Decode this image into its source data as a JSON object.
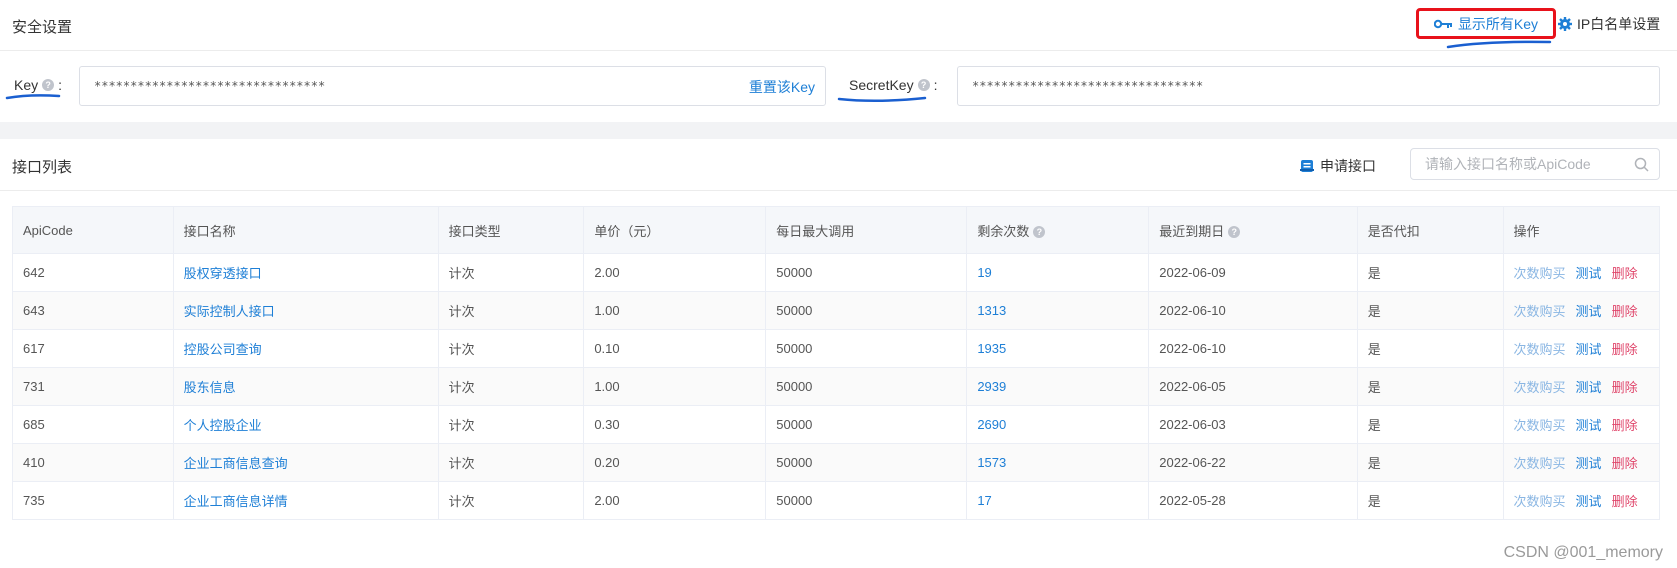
{
  "security": {
    "title": "安全设置",
    "show_all_keys_label": "显示所有Key",
    "ip_whitelist_label": "IP白名单设置",
    "key_label": "Key",
    "key_value": "********************************",
    "reset_key_label": "重置该Key",
    "secret_key_label": "SecretKey",
    "secret_key_value": "********************************",
    "colon": ":"
  },
  "api_list": {
    "title": "接口列表",
    "apply_label": "申请接口",
    "search_placeholder": "请输入接口名称或ApiCode",
    "columns": [
      "ApiCode",
      "接口名称",
      "接口类型",
      "单价（元）",
      "每日最大调用",
      "剩余次数",
      "最近到期日",
      "是否代扣",
      "操作"
    ],
    "actions": {
      "buy": "次数购买",
      "test": "测试",
      "delete": "删除"
    },
    "rows": [
      {
        "code": "642",
        "name": "股权穿透接口",
        "type": "计次",
        "price": "2.00",
        "max_daily": "50000",
        "remaining": "19",
        "expiry": "2022-06-09",
        "deduct": "是"
      },
      {
        "code": "643",
        "name": "实际控制人接口",
        "type": "计次",
        "price": "1.00",
        "max_daily": "50000",
        "remaining": "1313",
        "expiry": "2022-06-10",
        "deduct": "是"
      },
      {
        "code": "617",
        "name": "控股公司查询",
        "type": "计次",
        "price": "0.10",
        "max_daily": "50000",
        "remaining": "1935",
        "expiry": "2022-06-10",
        "deduct": "是"
      },
      {
        "code": "731",
        "name": "股东信息",
        "type": "计次",
        "price": "1.00",
        "max_daily": "50000",
        "remaining": "2939",
        "expiry": "2022-06-05",
        "deduct": "是"
      },
      {
        "code": "685",
        "name": "个人控股企业",
        "type": "计次",
        "price": "0.30",
        "max_daily": "50000",
        "remaining": "2690",
        "expiry": "2022-06-03",
        "deduct": "是"
      },
      {
        "code": "410",
        "name": "企业工商信息查询",
        "type": "计次",
        "price": "0.20",
        "max_daily": "50000",
        "remaining": "1573",
        "expiry": "2022-06-22",
        "deduct": "是"
      },
      {
        "code": "735",
        "name": "企业工商信息详情",
        "type": "计次",
        "price": "2.00",
        "max_daily": "50000",
        "remaining": "17",
        "expiry": "2022-05-28",
        "deduct": "是"
      }
    ]
  },
  "watermark": "CSDN @001_memory",
  "colors": {
    "link": "#1e7fd6",
    "highlight_border": "#e8121b",
    "delete": "#e0466b",
    "annotation_pen": "#1a5fd0"
  }
}
